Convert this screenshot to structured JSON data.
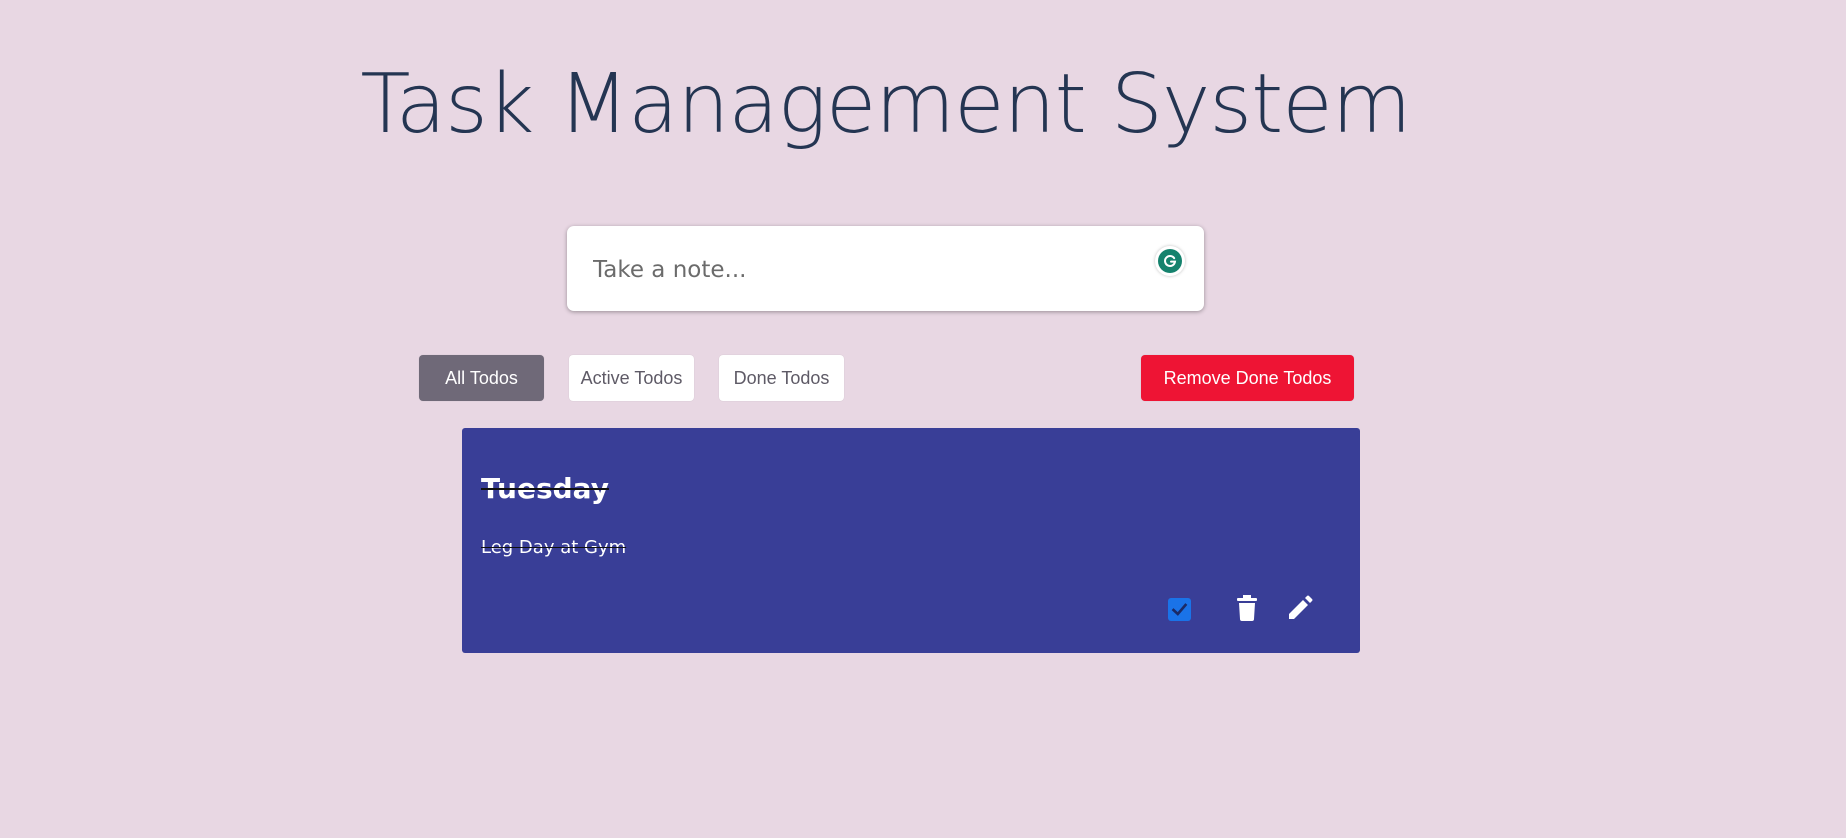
{
  "header": {
    "title": "Task Management System"
  },
  "note_input": {
    "placeholder": "Take a note...",
    "value": "",
    "assistant_icon": "grammarly-icon"
  },
  "filters": {
    "all_label": "All Todos",
    "active_label": "Active Todos",
    "done_label": "Done Todos",
    "selected": "All Todos",
    "remove_done_label": "Remove Done Todos"
  },
  "todos": [
    {
      "title": "Tuesday",
      "text": "Leg Day at Gym",
      "done": true,
      "actions": [
        "checkbox-icon",
        "trash-icon",
        "pencil-icon"
      ]
    }
  ],
  "colors": {
    "background": "#e8d7e3",
    "title": "#243552",
    "card": "#393e97",
    "selected_filter": "#6f6978",
    "remove_button": "#ee1434",
    "checkbox": "#1a73e8",
    "grammarly": "#15826d"
  }
}
